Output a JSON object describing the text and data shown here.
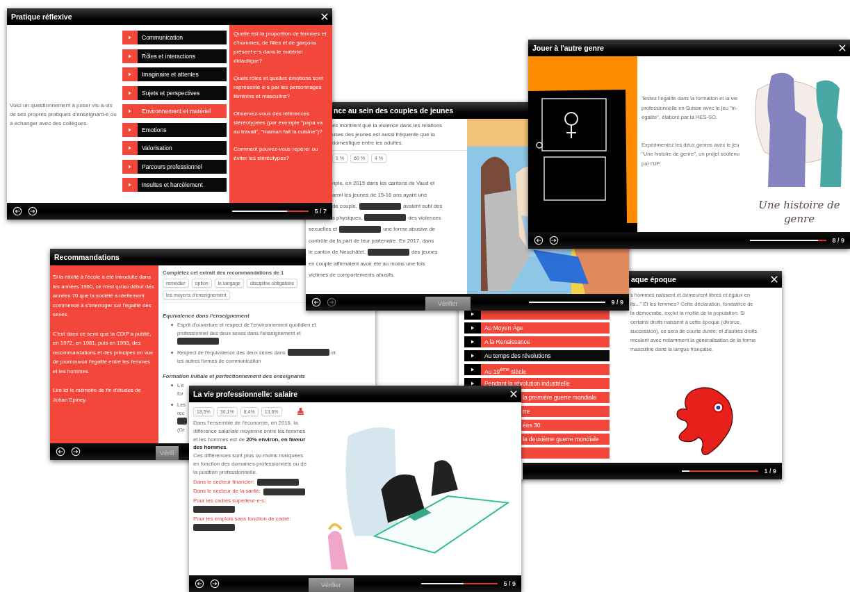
{
  "windows": [
    {
      "kind": "reflexive",
      "title": "Pratique réflexive",
      "closable": true,
      "forward_disabled": false,
      "intro": "Voici un questionnement à poser vis-à-vis de ses propres pratiques d'enseignant·e ou à échanger avec des collègues.",
      "menu": [
        {
          "label": "Communication",
          "selected": false
        },
        {
          "label": "Rôles et interactions",
          "selected": false
        },
        {
          "label": "Imaginaire et attentes",
          "selected": false
        },
        {
          "label": "Sujets et perspectives",
          "selected": false
        },
        {
          "label": "Environnement et matériel",
          "selected": true
        },
        {
          "label": "Emotions",
          "selected": false
        },
        {
          "label": "Valorisation",
          "selected": false
        },
        {
          "label": "Parcours professionnel",
          "selected": false
        },
        {
          "label": "Insultes et harcèlement",
          "selected": false
        }
      ],
      "questions": [
        "Quelle est la proportion de femmes et d'hommes, de filles et de garçons présent·e·s dans le matériel didactique?",
        "Quels rôles et quelles émotions sont représenté·e·s par les personnages féminins et masculins?",
        "Observez-vous des références stéréotypées (par exemple \"papa va au travail\", \"maman fait la cuisine\")?",
        "Comment pouvez-vous repérer ou éviter les stéréotypes?"
      ],
      "level": 0.71,
      "page": "5 / 7"
    },
    {
      "kind": "violence",
      "title": "nce au sein des couples de jeunes",
      "forward_disabled": true,
      "intro_lines": [
        "es montrent que la violence dans les relations",
        "uses des jeunes est aussi fréquente que la",
        "domestique entre les adultes."
      ],
      "chips": [
        "1 %",
        "60 %",
        "4 %"
      ],
      "lines": [
        [
          {
            "kind": "text",
            "text": "nple, en 2015 dans les cantons de Vaud et"
          }
        ],
        [
          {
            "kind": "text",
            "text": "armi les jeunes de 15-16 ans ayant une"
          }
        ],
        [
          {
            "kind": "text",
            "text": "de couple,"
          },
          {
            "kind": "blank"
          },
          {
            "kind": "text",
            "text": "avaient subi des"
          }
        ],
        [
          {
            "kind": "text",
            "text": "s physiques,"
          },
          {
            "kind": "blank"
          },
          {
            "kind": "text",
            "text": "des violences"
          }
        ],
        [
          {
            "kind": "text",
            "text": "sexuelles et"
          },
          {
            "kind": "blank"
          },
          {
            "kind": "text",
            "text": "une forme abusive de"
          }
        ],
        [
          {
            "kind": "text",
            "text": "contrôle de la part de leur partenaire. En 2017, dans"
          }
        ],
        [
          {
            "kind": "text",
            "text": "le canton de Neuchâtel,"
          },
          {
            "kind": "blank"
          },
          {
            "kind": "text",
            "text": "des jeunes"
          }
        ],
        [
          {
            "kind": "text",
            "text": "en couple affirmaient avoir été au moins une fois"
          }
        ],
        [
          {
            "kind": "text",
            "text": "victimes de comportements abusifs."
          }
        ]
      ],
      "button": "Vérifier",
      "level": 1,
      "page": "9 / 9"
    },
    {
      "kind": "game",
      "title": "Jouer à l'autre genre",
      "closable": true,
      "forward_disabled": false,
      "paragraphs": [
        "Testez l'égalité dans la formation et la vie professionnelle en Suisse avec le jeu \"in-egalite\", élaboré par la HES-SO.",
        "Expérimentez les deux genres avec le jeu \"Une histoire de genre\", un projet soutenu par l'UF."
      ],
      "caption": "Une histoire de genre",
      "level": 0.89,
      "page": "8 / 9"
    },
    {
      "kind": "recommendations",
      "title": "Recommandations",
      "forward_disabled": false,
      "paragraphs": [
        "Si la mixité à l'école a été introduite dans les années 1960, ce n'est qu'au début des années 70 que la société a réellement commencé à s'interroger sur l'égalité des sexes.",
        "C'est dans ce sens que la CDIP a publié, en 1972, en 1981, puis en 1993, des recommandations et des principes en vue de promouvoir l'égalité entre les femmes et les hommes.",
        "Lire ici le mémoire de fin d'études de Johan Epiney."
      ],
      "prompt": "Complétez cet extrait des recommandations de 1",
      "chips": [
        "remédier",
        "option",
        "le langage",
        "discipline obligatoire",
        "les moyens d'enseignement"
      ],
      "sections": [
        {
          "heading": "Equivalence dans l'enseignement",
          "items": [
            [
              [
                {
                  "kind": "text",
                  "text": "Esprit d'ouverture et respect de l'environnement quotidien et"
                }
              ],
              [
                {
                  "kind": "text",
                  "text": "professionnel des deux sexes dans l'enseignement et"
                }
              ],
              [
                {
                  "kind": "blank"
                }
              ]
            ],
            [
              [
                {
                  "kind": "text",
                  "text": "Respect de l'équivalence des deux sexes dans"
                },
                {
                  "kind": "blank"
                },
                {
                  "kind": "text",
                  "text": "et"
                }
              ],
              [
                {
                  "kind": "text",
                  "text": "les autres formes de communication"
                }
              ]
            ]
          ]
        },
        {
          "heading": "Formation initiale et perfectionnement des enseignants",
          "items": [
            [
              [
                {
                  "kind": "text",
                  "text": "L'é"
                }
              ],
              [
                {
                  "kind": "text",
                  "text": "for"
                }
              ]
            ],
            [
              [
                {
                  "kind": "text",
                  "text": "Les"
                }
              ],
              [
                {
                  "kind": "text",
                  "text": "rec"
                }
              ],
              [
                {
                  "kind": "blank"
                }
              ],
              [
                {
                  "kind": "text",
                  "text": "(Gr"
                }
              ]
            ]
          ]
        }
      ],
      "button": "Vérifi"
    },
    {
      "kind": "epoch",
      "title": "aque époque",
      "closable": true,
      "items": [
        {
          "selected": false
        },
        {
          "label": "Au Moyen Âge",
          "selected": false
        },
        {
          "label": "A la Renaissance",
          "selected": false
        },
        {
          "label": "Au temps des révolutions",
          "selected": true
        },
        {
          "label": "Au 19$^{ème}$ siècle",
          "selected": false
        },
        {
          "label": "Pendant la révolution industrielle",
          "selected": false
        },
        {
          "label": "la première guerre mondiale",
          "selected": false
        },
        {
          "label": "rre",
          "selected": false
        },
        {
          "label": "ées 30",
          "selected": false
        },
        {
          "label": "la deuxième guerre mondiale",
          "selected": false
        },
        {
          "selected": false
        }
      ],
      "text_lines": [
        "s hommes naissent et demeurent libres et égaux en",
        "its...\" Et les femmes? Cette déclaration, fondatrice de",
        "la démocratie, exclut la moitié de la population. Si",
        "certains droits naissent à cette époque (divorce,",
        "succession), ce sera de courte durée; et d'autres droits",
        "reculent avec notamment la généralisation de la forme",
        "masculine dans la langue française."
      ],
      "level": 0.1,
      "page": "1 / 9"
    },
    {
      "kind": "salary",
      "title": "La vie professionnelle: salaire",
      "closable": true,
      "forward_disabled": false,
      "chips": [
        "18,5%",
        "30,1%",
        "8,4%",
        "13,6%"
      ],
      "paragraphs": [
        "Dans l'ensemble de l'économie, en 2016, la différence salariale moyenne entre les femmes et les hommes est de **20% environ, en faveur des hommes**.",
        "Ces différences sont plus ou moins marquées en fonction des domaines professionnels ou de la position professionnelle."
      ],
      "answers": [
        {
          "label": "Dans le secteur financier:"
        },
        {
          "label": "Dans le secteur de la santé:"
        },
        {
          "label": "Pour les cadres supérieur·e·s:"
        },
        {
          "label": "Pour les emplois sans fonction de cadre:"
        }
      ],
      "button": "Vérifier",
      "level": 0.55,
      "page": "5 / 9"
    }
  ]
}
